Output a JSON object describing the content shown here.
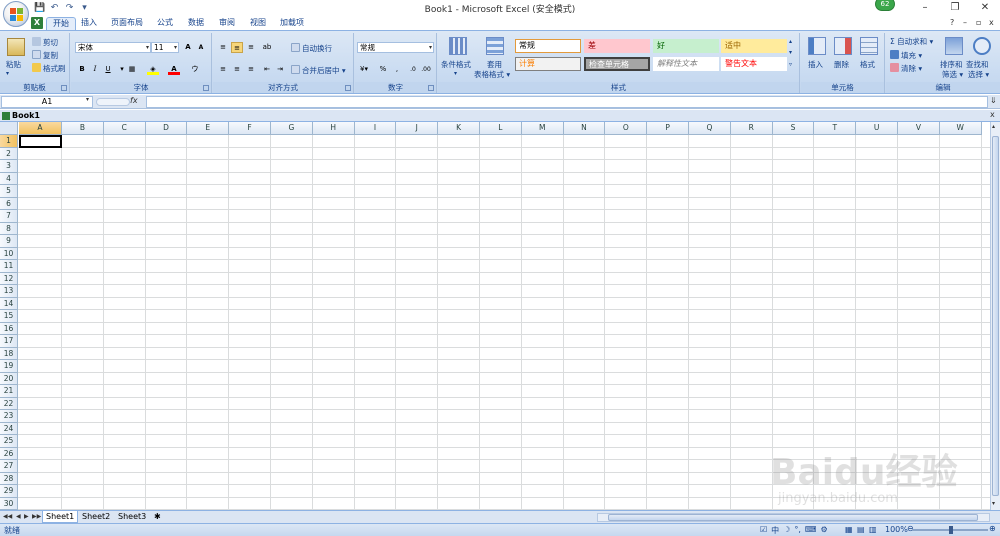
{
  "window": {
    "title": "Book1 - Microsoft Excel (安全模式)",
    "badge": "62",
    "minimize": "–",
    "restore": "❐",
    "close": "✕"
  },
  "qat": {
    "save": "💾",
    "undo": "↶",
    "redo": "↷",
    "more": "▾"
  },
  "tabs": [
    "开始",
    "插入",
    "页面布局",
    "公式",
    "数据",
    "审阅",
    "视图",
    "加载项"
  ],
  "active_tab": "开始",
  "clipboard": {
    "paste": "粘贴",
    "cut": "剪切",
    "copy": "复制",
    "format_painter": "格式刷",
    "label": "剪贴板"
  },
  "font": {
    "name": "宋体",
    "size": "11",
    "grow": "A",
    "shrink": "A",
    "bold": "B",
    "italic": "I",
    "underline": "U",
    "label": "字体"
  },
  "alignment": {
    "wrap": "自动换行",
    "merge": "合并后居中",
    "label": "对齐方式"
  },
  "number": {
    "format": "常规",
    "percent": "%",
    "comma": ",",
    "label": "数字"
  },
  "styles": {
    "conditional": "条件格式",
    "table_line1": "套用",
    "table_line2": "表格格式",
    "cells": [
      {
        "text": "常规",
        "bg": "#ffffff",
        "fg": "#000000",
        "border": "#e39a3c"
      },
      {
        "text": "差",
        "bg": "#ffc7ce",
        "fg": "#9c0006",
        "border": "#ffc7ce"
      },
      {
        "text": "好",
        "bg": "#c6efce",
        "fg": "#006100",
        "border": "#c6efce"
      },
      {
        "text": "适中",
        "bg": "#ffeb9c",
        "fg": "#9c6500",
        "border": "#ffeb9c"
      },
      {
        "text": "计算",
        "bg": "#f2f2f2",
        "fg": "#fa7d00",
        "border": "#7f7f7f"
      },
      {
        "text": "检查单元格",
        "bg": "#a5a5a5",
        "fg": "#ffffff",
        "border": "#3f3f3f"
      },
      {
        "text": "解释性文本",
        "bg": "#ffffff",
        "fg": "#7f7f7f",
        "border": "#ffffff"
      },
      {
        "text": "警告文本",
        "bg": "#ffffff",
        "fg": "#ff0000",
        "border": "#ffffff"
      }
    ],
    "label": "样式"
  },
  "cells_group": {
    "insert": "插入",
    "delete": "删除",
    "format": "格式",
    "label": "单元格"
  },
  "editing": {
    "autosum": "自动求和",
    "fill": "填充",
    "clear": "清除",
    "sort_line1": "排序和",
    "sort_line2": "筛选",
    "find_line1": "查找和",
    "find_line2": "选择",
    "label": "编辑"
  },
  "formula_bar": {
    "name_box": "A1",
    "fx": "fx",
    "value": ""
  },
  "workbook": {
    "name": "Book1"
  },
  "columns": [
    "A",
    "B",
    "C",
    "D",
    "E",
    "F",
    "G",
    "H",
    "I",
    "J",
    "K",
    "L",
    "M",
    "N",
    "O",
    "P",
    "Q",
    "R",
    "S",
    "T",
    "U",
    "V",
    "W"
  ],
  "rows": [
    "1",
    "2",
    "3",
    "4",
    "5",
    "6",
    "7",
    "8",
    "9",
    "10",
    "11",
    "12",
    "13",
    "14",
    "15",
    "16",
    "17",
    "18",
    "19",
    "20",
    "21",
    "22",
    "23",
    "24",
    "25",
    "26",
    "27",
    "28",
    "29",
    "30"
  ],
  "selected_cell": "A1",
  "sheets": [
    "Sheet1",
    "Sheet2",
    "Sheet3"
  ],
  "active_sheet": "Sheet1",
  "status": {
    "ready": "就绪",
    "zoom": "100%",
    "ime": "中"
  },
  "watermark": {
    "brand": "Baidu经验",
    "url": "jingyan.baidu.com"
  },
  "colors": {
    "ribbon": "#c9dbf1",
    "accent": "#15428b",
    "selected_header": "#f1c15f"
  }
}
